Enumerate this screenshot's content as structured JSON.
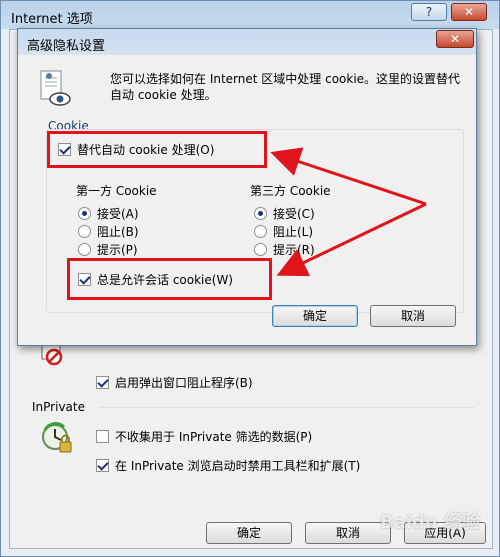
{
  "outer_window": {
    "title": "Internet 选项",
    "help_btn": "?",
    "close_btn": "✕",
    "popup_blocker_label": "启用弹出窗口阻止程序(B)",
    "inprivate_header": "InPrivate",
    "inprivate_no_collect_label": "不收集用于 InPrivate 筛选的数据(P)",
    "inprivate_disable_toolbars_label": "在 InPrivate 浏览启动时禁用工具栏和扩展(T)",
    "ok_label": "确定",
    "cancel_label": "取消",
    "apply_label": "应用(A)",
    "checks": {
      "popup_blocker": true,
      "no_collect": false,
      "disable_toolbars": true
    }
  },
  "dialog": {
    "title": "高级隐私设置",
    "close_btn": "✕",
    "description": "您可以选择如何在 Internet 区域中处理 cookie。这里的设置替代自动 cookie 处理。",
    "cookie_group_label": "Cookie",
    "override_label": "替代自动 cookie 处理(O)",
    "override_checked": true,
    "first_party_header": "第一方 Cookie",
    "third_party_header": "第三方 Cookie",
    "first_party_options": [
      "接受(A)",
      "阻止(B)",
      "提示(P)"
    ],
    "third_party_options": [
      "接受(C)",
      "阻止(L)",
      "提示(R)"
    ],
    "first_party_selected": 0,
    "third_party_selected": 0,
    "session_label": "总是允许会话 cookie(W)",
    "session_checked": true,
    "ok_label": "确定",
    "cancel_label": "取消"
  },
  "watermark": "Baidu 经验",
  "icons": [
    "privacy-document-eye-icon",
    "no-popup-icon",
    "inprivate-clock-icon",
    "help-icon",
    "close-icon"
  ],
  "colors": {
    "annotation_red": "#e0141a",
    "checkmark": "#1d2d7a"
  }
}
